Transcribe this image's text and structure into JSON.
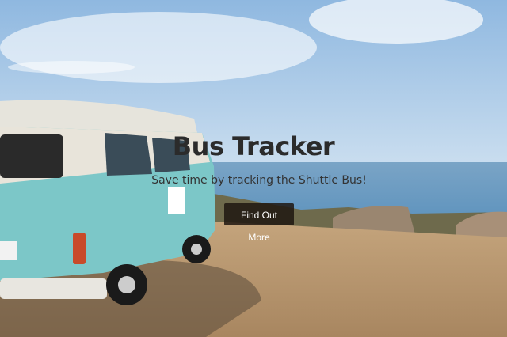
{
  "hero": {
    "title": "Bus Tracker",
    "subtitle": "Save time by tracking the Shuttle Bus!",
    "cta_label": "Find Out More"
  }
}
